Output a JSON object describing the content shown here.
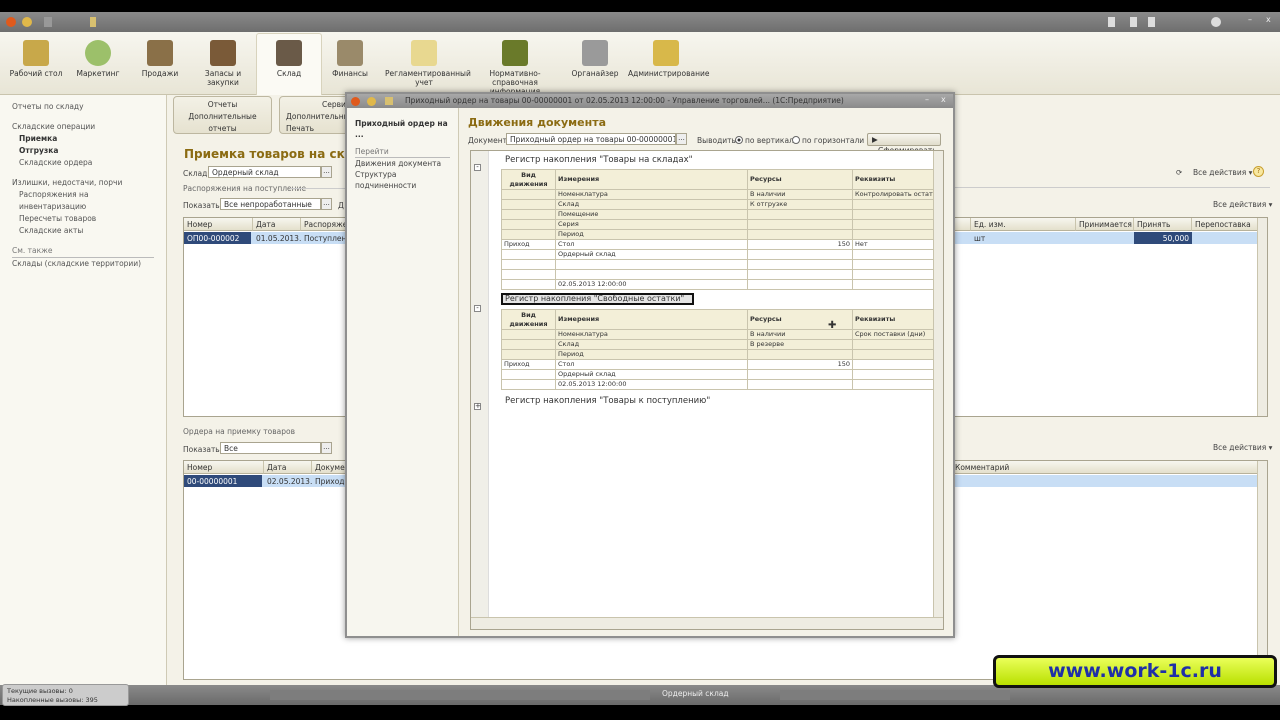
{
  "toolbar": {
    "items": [
      "Рабочий стол",
      "Маркетинг",
      "Продажи",
      "Запасы и закупки",
      "Склад",
      "Финансы",
      "Регламентированный учет",
      "Нормативно-справочная информация",
      "Органайзер",
      "Администрирование"
    ],
    "selected": "Склад"
  },
  "leftnav": {
    "reports": "Отчеты по складу",
    "ops_title": "Складские операции",
    "ops": [
      "Приемка",
      "Отгрузка",
      "Складские ордера"
    ],
    "inv_title": "Излишки, недостачи, порчи",
    "inv": [
      "Распоряжения на инвентаризацию",
      "Пересчеты товаров",
      "Складские акты"
    ],
    "see_also": "См. также",
    "see_items": [
      "Склады (складские территории)"
    ]
  },
  "main": {
    "groups": {
      "reports_title": "Отчеты",
      "reports_item": "Дополнительные отчеты",
      "service_title": "Сервис",
      "service_items": [
        "Дополнительные",
        "Печать этикеток"
      ]
    },
    "title": "Приемка товаров на склад",
    "warehouse_label": "Склад:",
    "warehouse_value": "Ордерный склад",
    "section1": "Распоряжения на поступление",
    "show_label": "Показать:",
    "show_value": "Все непроработанные",
    "show_extra": "Д",
    "all_actions": "Все действия ▾",
    "table1": {
      "columns": [
        "Номер",
        "Дата",
        "Распоряжение",
        "Ед. изм.",
        "Принимается",
        "Принять",
        "Перепоставка"
      ],
      "row": [
        "ОП00-000002",
        "01.05.2013...",
        "Поступление",
        "шт",
        "",
        "50,000",
        ""
      ]
    },
    "section2": "Ордера на приемку товаров",
    "show2_value": "Все",
    "table2": {
      "columns": [
        "Номер",
        "Дата",
        "Документ",
        "Комментарий"
      ],
      "row": [
        "00-00000001",
        "02.05.2013...",
        "Приходный",
        ""
      ]
    }
  },
  "modal": {
    "title": "Приходный ордер на товары 00-00000001 от 02.05.2013 12:00:00 - Управление торговлей... (1С:Предприятие)",
    "left_title": "Приходный ордер на ...",
    "goto": "Перейти",
    "nav": [
      "Движения документа",
      "Структура подчиненности"
    ],
    "heading": "Движения документа",
    "doc_label": "Документ:",
    "doc_value": "Приходный ордер на товары 00-00000001 от 02.05.",
    "output_label": "Выводить:",
    "opt_vertical": "по вертикали",
    "opt_horizontal": "по горизонтали",
    "output_selected": "по вертикали",
    "generate": "Сформировать",
    "reg1": {
      "title": "Регистр накопления \"Товары на складах\"",
      "headers": [
        "Вид движения",
        "Измерения",
        "Ресурсы",
        "Реквизиты"
      ],
      "head_rows": [
        [
          "",
          "Номенклатура",
          "В наличии",
          "Контролировать остат"
        ],
        [
          "",
          "Склад",
          "К отгрузке",
          ""
        ],
        [
          "",
          "Помещение",
          "",
          ""
        ],
        [
          "",
          "Серия",
          "",
          ""
        ],
        [
          "",
          "Период",
          "",
          ""
        ]
      ],
      "rows": [
        [
          "Приход",
          "Стол",
          "150",
          "Нет"
        ],
        [
          "",
          "Ордерный склад",
          "",
          ""
        ],
        [
          "",
          "",
          "",
          ""
        ],
        [
          "",
          "",
          "",
          ""
        ],
        [
          "",
          "02.05.2013 12:00:00",
          "",
          ""
        ]
      ]
    },
    "reg2": {
      "title": "Регистр накопления \"Свободные остатки\"",
      "headers": [
        "Вид движения",
        "Измерения",
        "Ресурсы",
        "Реквизиты"
      ],
      "head_rows": [
        [
          "",
          "Номенклатура",
          "В наличии",
          "Срок поставки (дни)"
        ],
        [
          "",
          "Склад",
          "В резерве",
          ""
        ],
        [
          "",
          "Период",
          "",
          ""
        ]
      ],
      "rows": [
        [
          "Приход",
          "Стол",
          "150",
          ""
        ],
        [
          "",
          "Ордерный склад",
          "",
          ""
        ],
        [
          "",
          "02.05.2013 12:00:00",
          "",
          ""
        ]
      ]
    },
    "reg3": {
      "title": "Регистр накопления \"Товары к поступлению\""
    }
  },
  "status": {
    "calls_current": "Текущие вызовы: 0",
    "calls_total": "Накопленные вызовы: 395",
    "task": "Ордерный склад"
  },
  "watermark": "www.work-1c.ru"
}
